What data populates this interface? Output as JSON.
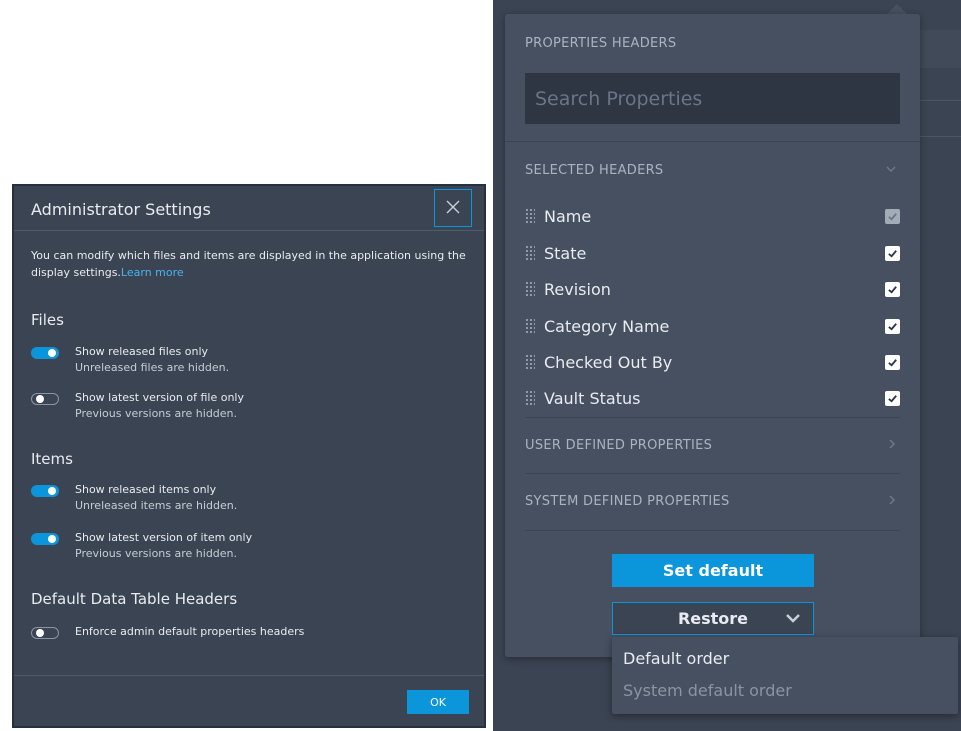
{
  "properties_panel": {
    "title": "PROPERTIES HEADERS",
    "search_placeholder": "Search Properties",
    "selected_headers_title": "SELECTED HEADERS",
    "headers": [
      {
        "label": "Name",
        "checked": true,
        "disabled": true
      },
      {
        "label": "State",
        "checked": true,
        "disabled": false
      },
      {
        "label": "Revision",
        "checked": true,
        "disabled": false
      },
      {
        "label": "Category Name",
        "checked": true,
        "disabled": false
      },
      {
        "label": "Checked Out By",
        "checked": true,
        "disabled": false
      },
      {
        "label": "Vault Status",
        "checked": true,
        "disabled": false
      }
    ],
    "user_defined_title": "USER DEFINED PROPERTIES",
    "system_defined_title": "SYSTEM DEFINED PROPERTIES",
    "set_default_label": "Set default",
    "restore_label": "Restore",
    "restore_options": [
      "Default order",
      "System default order"
    ]
  },
  "admin_dialog": {
    "title": "Administrator Settings",
    "description": "You can modify which files and items are displayed in the application using the display settings.",
    "learn_more": "Learn more",
    "files_section": "Files",
    "files_toggles": [
      {
        "label": "Show released files only",
        "sub": "Unreleased files are hidden.",
        "on": true
      },
      {
        "label": "Show latest version of file only",
        "sub": "Previous versions are hidden.",
        "on": false
      }
    ],
    "items_section": "Items",
    "items_toggles": [
      {
        "label": "Show released items only",
        "sub": "Unreleased items are hidden.",
        "on": true
      },
      {
        "label": "Show latest version of item only",
        "sub": "Previous versions are hidden.",
        "on": true
      }
    ],
    "headers_section": "Default Data Table Headers",
    "headers_toggle": {
      "label": "Enforce admin default properties headers",
      "on": false
    },
    "ok_label": "OK"
  },
  "colors": {
    "accent": "#0b96dc",
    "link": "#4ab3ee",
    "panel_bg": "#465061",
    "dialog_bg": "#3b4453"
  },
  "icons": [
    "close-icon",
    "chevron-down-icon",
    "chevron-right-icon",
    "drag-handle-icon",
    "checkbox-checked-icon"
  ]
}
